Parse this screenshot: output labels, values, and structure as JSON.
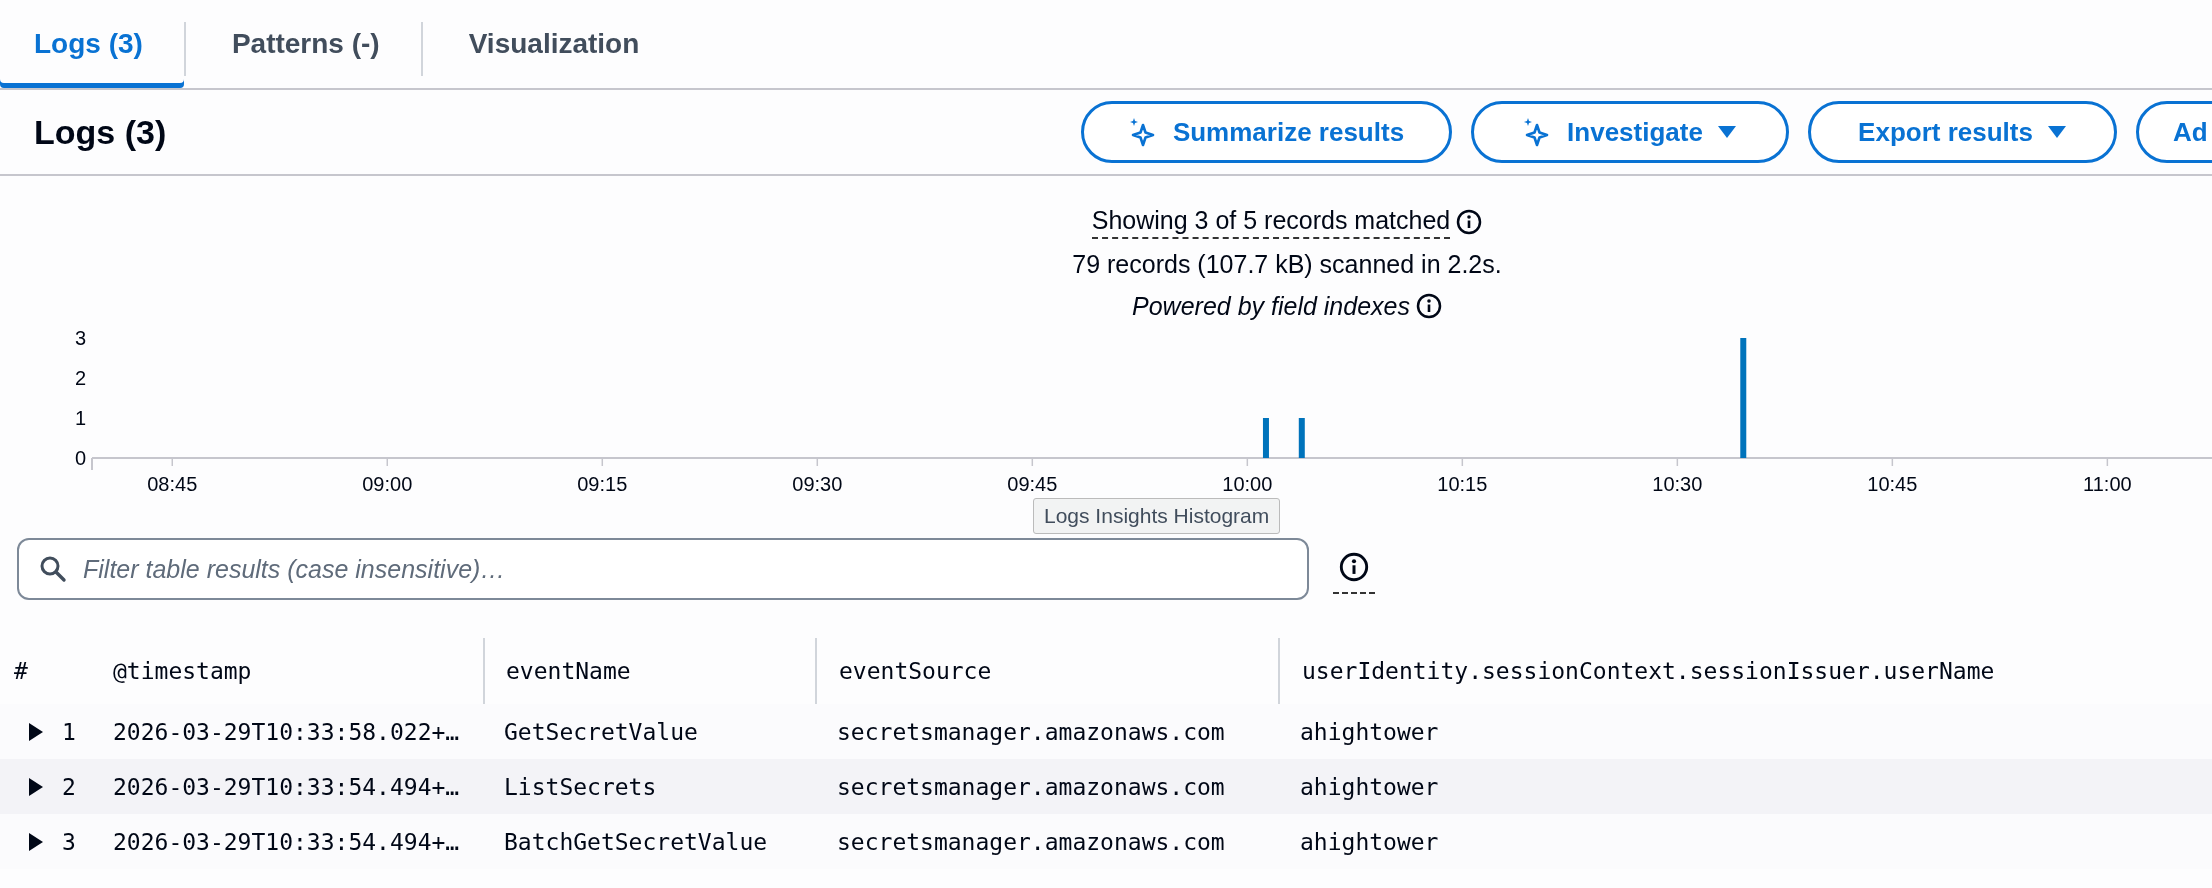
{
  "tabs": [
    {
      "label": "Logs (3)",
      "selected": true
    },
    {
      "label": "Patterns (-)",
      "selected": false
    },
    {
      "label": "Visualization",
      "selected": false
    }
  ],
  "header": {
    "title": "Logs (3)",
    "buttons": [
      {
        "label": "Summarize results",
        "kind": "sparkle"
      },
      {
        "label": "Investigate",
        "kind": "sparkle-dropdown"
      },
      {
        "label": "Export results",
        "kind": "dropdown"
      },
      {
        "label": "Ad",
        "kind": "plain"
      }
    ]
  },
  "summary": {
    "matched": "Showing 3 of 5 records matched",
    "scanned": "79 records (107.7 kB) scanned in 2.2s.",
    "powered": "Powered by field indexes"
  },
  "histogram": {
    "tooltip": "Logs Insights Histogram",
    "chart_data": {
      "type": "bar",
      "x": [
        601.3,
        603.8,
        634.6
      ],
      "values": [
        1,
        1,
        3
      ],
      "xlim": [
        519.4,
        667.3
      ],
      "ylim": [
        0,
        3
      ],
      "yticks": [
        0,
        1,
        2,
        3
      ],
      "xticks": [
        {
          "value": 525,
          "label": "08:45"
        },
        {
          "value": 540,
          "label": "09:00"
        },
        {
          "value": 555,
          "label": "09:15"
        },
        {
          "value": 570,
          "label": "09:30"
        },
        {
          "value": 585,
          "label": "09:45"
        },
        {
          "value": 600,
          "label": "10:00"
        },
        {
          "value": 615,
          "label": "10:15"
        },
        {
          "value": 630,
          "label": "10:30"
        },
        {
          "value": 645,
          "label": "10:45"
        },
        {
          "value": 660,
          "label": "11:00"
        }
      ]
    }
  },
  "filter": {
    "placeholder": "Filter table results (case insensitive)…"
  },
  "table": {
    "columns": [
      "#",
      "@timestamp",
      "eventName",
      "eventSource",
      "userIdentity.sessionContext.sessionIssuer.userName"
    ],
    "rows": [
      {
        "expanded": false,
        "cells": [
          "1",
          "2026-03-29T10:33:58.022+…",
          "GetSecretValue",
          "secretsmanager.amazonaws.com",
          "ahightower"
        ]
      },
      {
        "expanded": false,
        "cells": [
          "2",
          "2026-03-29T10:33:54.494+…",
          "ListSecrets",
          "secretsmanager.amazonaws.com",
          "ahightower"
        ]
      },
      {
        "expanded": false,
        "cells": [
          "3",
          "2026-03-29T10:33:54.494+…",
          "BatchGetSecretValue",
          "secretsmanager.amazonaws.com",
          "ahightower"
        ]
      }
    ]
  }
}
